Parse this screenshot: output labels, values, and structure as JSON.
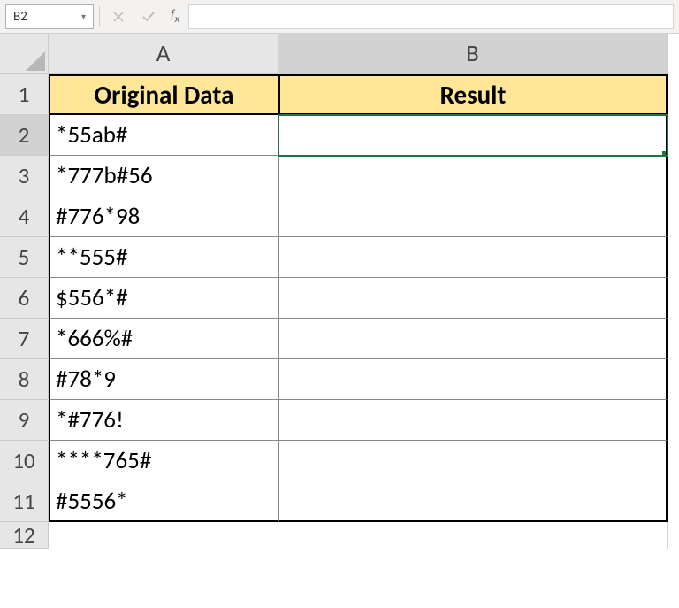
{
  "nameBox": "B2",
  "formulaBar": "",
  "columns": [
    "A",
    "B"
  ],
  "rows": [
    "1",
    "2",
    "3",
    "4",
    "5",
    "6",
    "7",
    "8",
    "9",
    "10",
    "11",
    "12"
  ],
  "headers": {
    "A": "Original Data",
    "B": "Result"
  },
  "data": {
    "A2": "*55ab#",
    "A3": "*777b#56",
    "A4": "#776*98",
    "A5": "**555#",
    "A6": "$556*#",
    "A7": "*666%#",
    "A8": "#78*9",
    "A9": "*#776!",
    "A10": "****765#",
    "A11": "#5556*"
  },
  "activeCell": "B2"
}
